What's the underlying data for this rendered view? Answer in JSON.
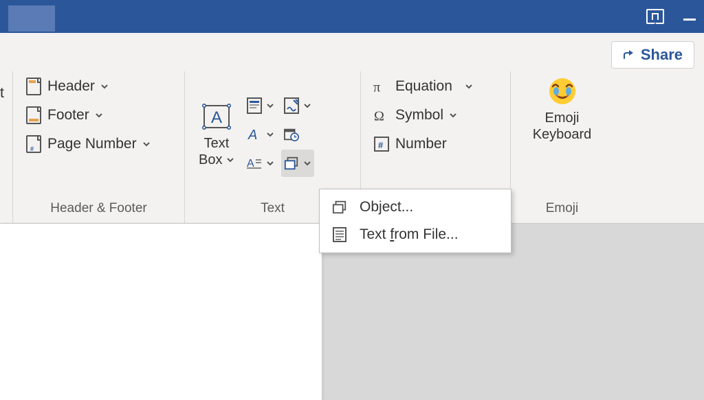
{
  "titlebar": {
    "ribbon_display_name": "ribbon-display-options",
    "minimize_name": "minimize"
  },
  "share": {
    "label": "Share"
  },
  "ribbon": {
    "groups": {
      "header_footer": {
        "label": "Header & Footer",
        "header": "Header",
        "footer": "Footer",
        "page_number": "Page Number"
      },
      "text": {
        "label": "Text",
        "text_box_line1": "Text",
        "text_box_line2": "Box",
        "quick_parts": "Quick Parts",
        "wordart": "WordArt",
        "drop_cap": "Drop Cap",
        "signature": "Signature Line",
        "date_time": "Date & Time",
        "object": "Object"
      },
      "symbols": {
        "label": "",
        "equation": "Equation",
        "symbol": "Symbol",
        "number": "Number"
      },
      "emoji": {
        "label": "Emoji",
        "emoji_line1": "Emoji",
        "emoji_line2": "Keyboard"
      }
    }
  },
  "dropdown": {
    "object_pre": "Ob",
    "object_u": "j",
    "object_post": "ect...",
    "text_pre": "Text ",
    "text_u": "f",
    "text_post": "rom File..."
  }
}
